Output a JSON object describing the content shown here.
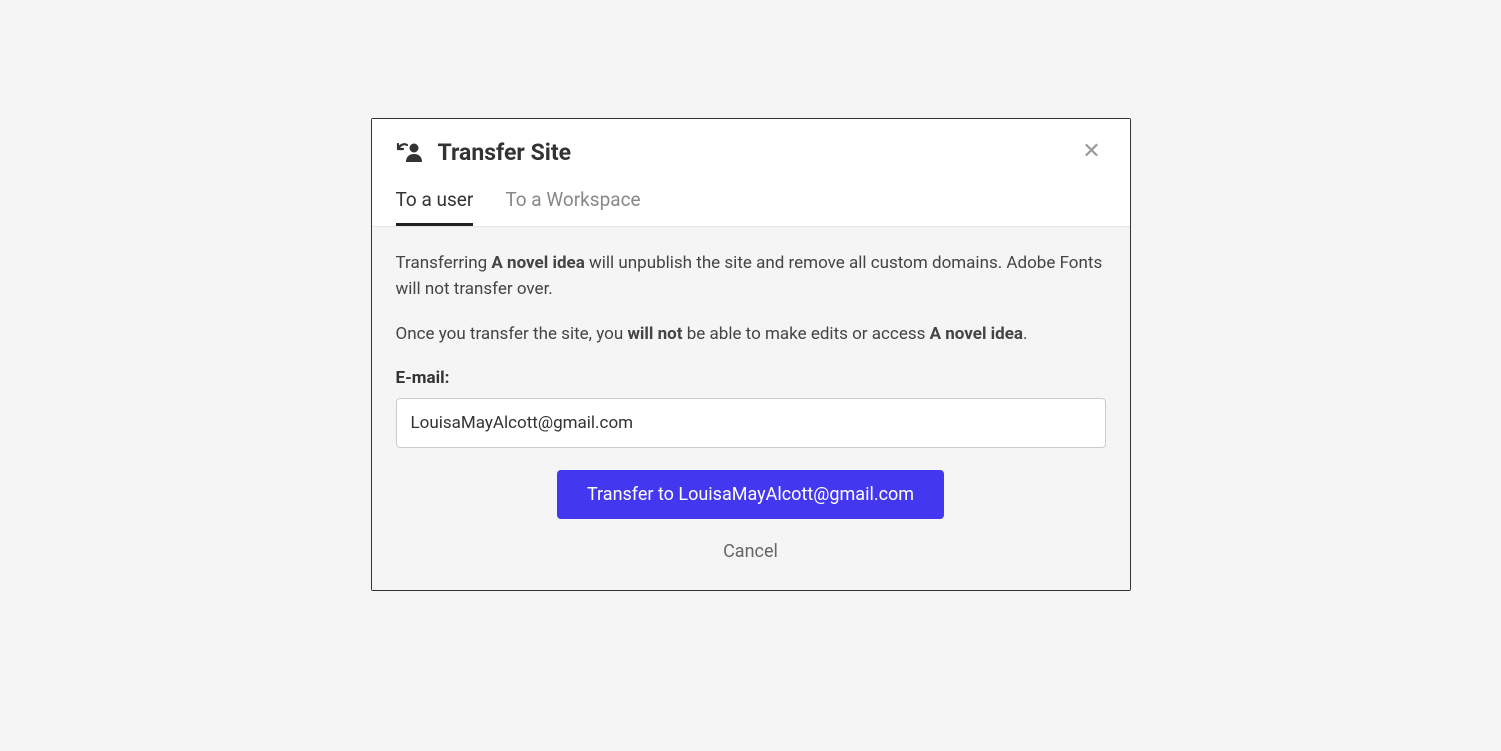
{
  "modal": {
    "title": "Transfer Site",
    "tabs": {
      "user": "To a user",
      "workspace": "To a Workspace"
    },
    "site_name": "A novel idea",
    "info": {
      "p1_prefix": "Transferring ",
      "p1_suffix": " will unpublish the site and remove all custom domains. Adobe Fonts will not transfer over.",
      "p2_prefix": "Once you transfer the site, you ",
      "p2_will_not": "will not",
      "p2_mid": " be able to make edits or access ",
      "p2_suffix": "."
    },
    "email_label": "E-mail:",
    "email_value": "LouisaMayAlcott@gmail.com",
    "transfer_button": "Transfer to LouisaMayAlcott@gmail.com",
    "cancel_button": "Cancel"
  }
}
